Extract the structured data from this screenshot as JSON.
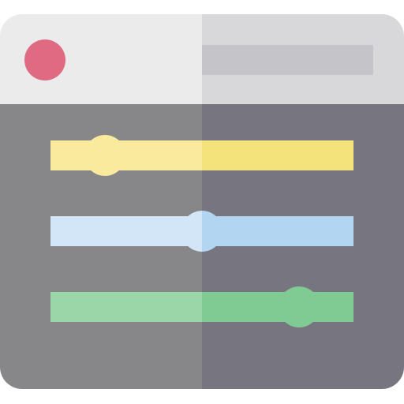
{
  "window": {
    "titlebar": {
      "left_color": "#ebebec",
      "right_color": "#d8d8da"
    },
    "body": {
      "left_color": "#87878a",
      "right_color": "#77757f"
    },
    "close_button": {
      "icon": "circle-dot-icon",
      "color": "#e06a82"
    },
    "address_bar": {
      "value": "",
      "color": "#c5c5c9"
    }
  },
  "sliders": [
    {
      "name": "slider-yellow",
      "value": 0.18,
      "colors": {
        "light": "#faea9e",
        "dark": "#f4e27a"
      }
    },
    {
      "name": "slider-blue",
      "value": 0.5,
      "colors": {
        "light": "#d2e6f7",
        "dark": "#b2d6f2"
      }
    },
    {
      "name": "slider-green",
      "value": 0.82,
      "colors": {
        "light": "#9bd6a9",
        "dark": "#80ca93"
      }
    }
  ]
}
